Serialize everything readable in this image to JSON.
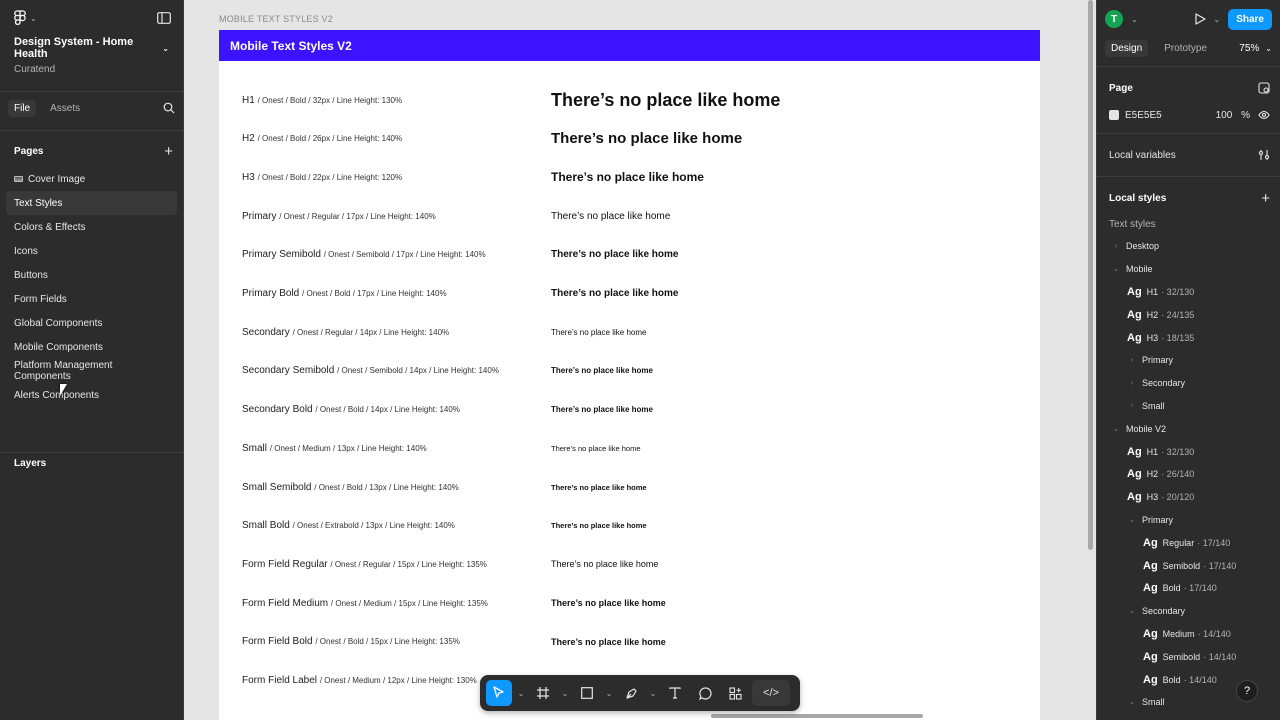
{
  "left_panel": {
    "project_name": "Design System - Home Health",
    "team": "Curatend",
    "tabs": [
      "File",
      "Assets"
    ],
    "pages_title": "Pages",
    "pages": [
      {
        "label": "Cover Image",
        "icon": "image-icon",
        "active": false
      },
      {
        "label": "Text Styles",
        "active": true
      },
      {
        "label": "Colors & Effects",
        "active": false
      },
      {
        "label": "Icons",
        "active": false
      },
      {
        "label": "Buttons",
        "active": false
      },
      {
        "label": "Form Fields",
        "active": false
      },
      {
        "label": "Global Components",
        "active": false
      },
      {
        "label": "Mobile Components",
        "active": false
      },
      {
        "label": "Platform Management Components",
        "active": false
      },
      {
        "label": "Alerts Components",
        "active": false
      }
    ],
    "layers_title": "Layers"
  },
  "canvas": {
    "frame_label": "MOBILE TEXT STYLES V2",
    "frame_title": "Mobile Text Styles V2",
    "rows": [
      {
        "name": "H1",
        "meta": "/ Onest / Bold / 32px / Line Height: 130%",
        "sample": "There’s no place like home",
        "size": 18,
        "weight": "bold"
      },
      {
        "name": "H2",
        "meta": "/ Onest / Bold / 26px / Line Height: 140%",
        "sample": "There’s no place like home",
        "size": 15,
        "weight": "bold"
      },
      {
        "name": "H3",
        "meta": "/ Onest / Bold / 22px / Line Height: 120%",
        "sample": "There’s no place like home",
        "size": 12,
        "weight": "bold"
      },
      {
        "name": "Primary",
        "meta": "/ Onest / Regular / 17px / Line Height: 140%",
        "sample": "There’s no place like home",
        "size": 10,
        "weight": "normal"
      },
      {
        "name": "Primary Semibold",
        "meta": "/ Onest / Semibold / 17px / Line Height: 140%",
        "sample": "There’s no place like home",
        "size": 10,
        "weight": "bold"
      },
      {
        "name": "Primary Bold",
        "meta": "/ Onest / Bold / 17px / Line Height: 140%",
        "sample": "There’s no place like home",
        "size": 10,
        "weight": "bold"
      },
      {
        "name": "Secondary",
        "meta": "/ Onest / Regular / 14px / Line Height: 140%",
        "sample": "There’s no place like home",
        "size": 8,
        "weight": "normal"
      },
      {
        "name": "Secondary Semibold",
        "meta": "/ Onest / Semibold / 14px / Line Height: 140%",
        "sample": "There’s no place like home",
        "size": 8,
        "weight": "bold"
      },
      {
        "name": "Secondary Bold",
        "meta": "/ Onest / Bold / 14px / Line Height: 140%",
        "sample": "There’s no place like home",
        "size": 8,
        "weight": "bold"
      },
      {
        "name": "Small",
        "meta": "/ Onest / Medium / 13px / Line Height: 140%",
        "sample": "There’s no place like home",
        "size": 7.5,
        "weight": "normal"
      },
      {
        "name": "Small Semibold",
        "meta": "/ Onest / Bold / 13px / Line Height: 140%",
        "sample": "There’s no place like home",
        "size": 7.5,
        "weight": "bold"
      },
      {
        "name": "Small Bold",
        "meta": "/ Onest / Extrabold / 13px / Line Height: 140%",
        "sample": "There’s no place like home",
        "size": 7.5,
        "weight": "bold"
      },
      {
        "name": "Form Field Regular",
        "meta": "/ Onest / Regular / 15px / Line Height: 135%",
        "sample": "There’s no place like home",
        "size": 9,
        "weight": "normal"
      },
      {
        "name": "Form Field Medium",
        "meta": "/ Onest / Medium / 15px / Line Height: 135%",
        "sample": "There’s no place like home",
        "size": 9,
        "weight": "bold"
      },
      {
        "name": "Form Field Bold",
        "meta": "/ Onest / Bold / 15px / Line Height: 135%",
        "sample": "There’s no place like home",
        "size": 9,
        "weight": "bold"
      },
      {
        "name": "Form Field Label",
        "meta": "/ Onest / Medium / 12px / Line Height: 130%",
        "sample": "",
        "size": 7,
        "weight": "normal"
      }
    ]
  },
  "right_panel": {
    "avatar_initial": "T",
    "share_label": "Share",
    "tabs": [
      "Design",
      "Prototype"
    ],
    "zoom": "75%",
    "page_title": "Page",
    "page_color": "E5E5E5",
    "page_opacity": "100",
    "page_opacity_unit": "%",
    "local_variables": "Local variables",
    "local_styles": "Local styles",
    "text_styles_label": "Text styles",
    "tree": [
      {
        "level": 0,
        "chev": "›",
        "label": "Desktop"
      },
      {
        "level": 0,
        "chev": "⌄",
        "label": "Mobile"
      },
      {
        "level": 1,
        "ag": "Ag",
        "label": "H1",
        "sub": "· 32/130"
      },
      {
        "level": 1,
        "ag": "Ag",
        "label": "H2",
        "sub": "· 24/135"
      },
      {
        "level": 1,
        "ag": "Ag",
        "label": "H3",
        "sub": "· 18/135"
      },
      {
        "level": 1,
        "chev": "›",
        "label": "Primary"
      },
      {
        "level": 1,
        "chev": "›",
        "label": "Secondary"
      },
      {
        "level": 1,
        "chev": "›",
        "label": "Small"
      },
      {
        "level": 0,
        "chev": "⌄",
        "label": "Mobile V2"
      },
      {
        "level": 1,
        "ag": "Ag",
        "label": "H1",
        "sub": "· 32/130"
      },
      {
        "level": 1,
        "ag": "Ag",
        "label": "H2",
        "sub": "· 26/140"
      },
      {
        "level": 1,
        "ag": "Ag",
        "label": "H3",
        "sub": "· 20/120"
      },
      {
        "level": 1,
        "chev": "⌄",
        "label": "Primary"
      },
      {
        "level": 2,
        "ag": "Ag",
        "label": "Regular",
        "sub": "· 17/140"
      },
      {
        "level": 2,
        "ag": "Ag",
        "label": "Semibold",
        "sub": "· 17/140"
      },
      {
        "level": 2,
        "ag": "Ag",
        "label": "Bold",
        "sub": "· 17/140"
      },
      {
        "level": 1,
        "chev": "⌄",
        "label": "Secondary"
      },
      {
        "level": 2,
        "ag": "Ag",
        "label": "Medium",
        "sub": "· 14/140"
      },
      {
        "level": 2,
        "ag": "Ag",
        "label": "Semibold",
        "sub": "· 14/140"
      },
      {
        "level": 2,
        "ag": "Ag",
        "label": "Bold",
        "sub": "· 14/140"
      },
      {
        "level": 1,
        "chev": "⌄",
        "label": "Small"
      },
      {
        "level": 2,
        "ag": "Ag",
        "label": "Medium",
        "sub": "· 13/140"
      }
    ],
    "help": "?"
  },
  "toolbar": {
    "code_label": "</>"
  },
  "colors": {
    "frame_header": "#3b13ff",
    "accent": "#0d99ff",
    "avatar": "#13a454"
  }
}
